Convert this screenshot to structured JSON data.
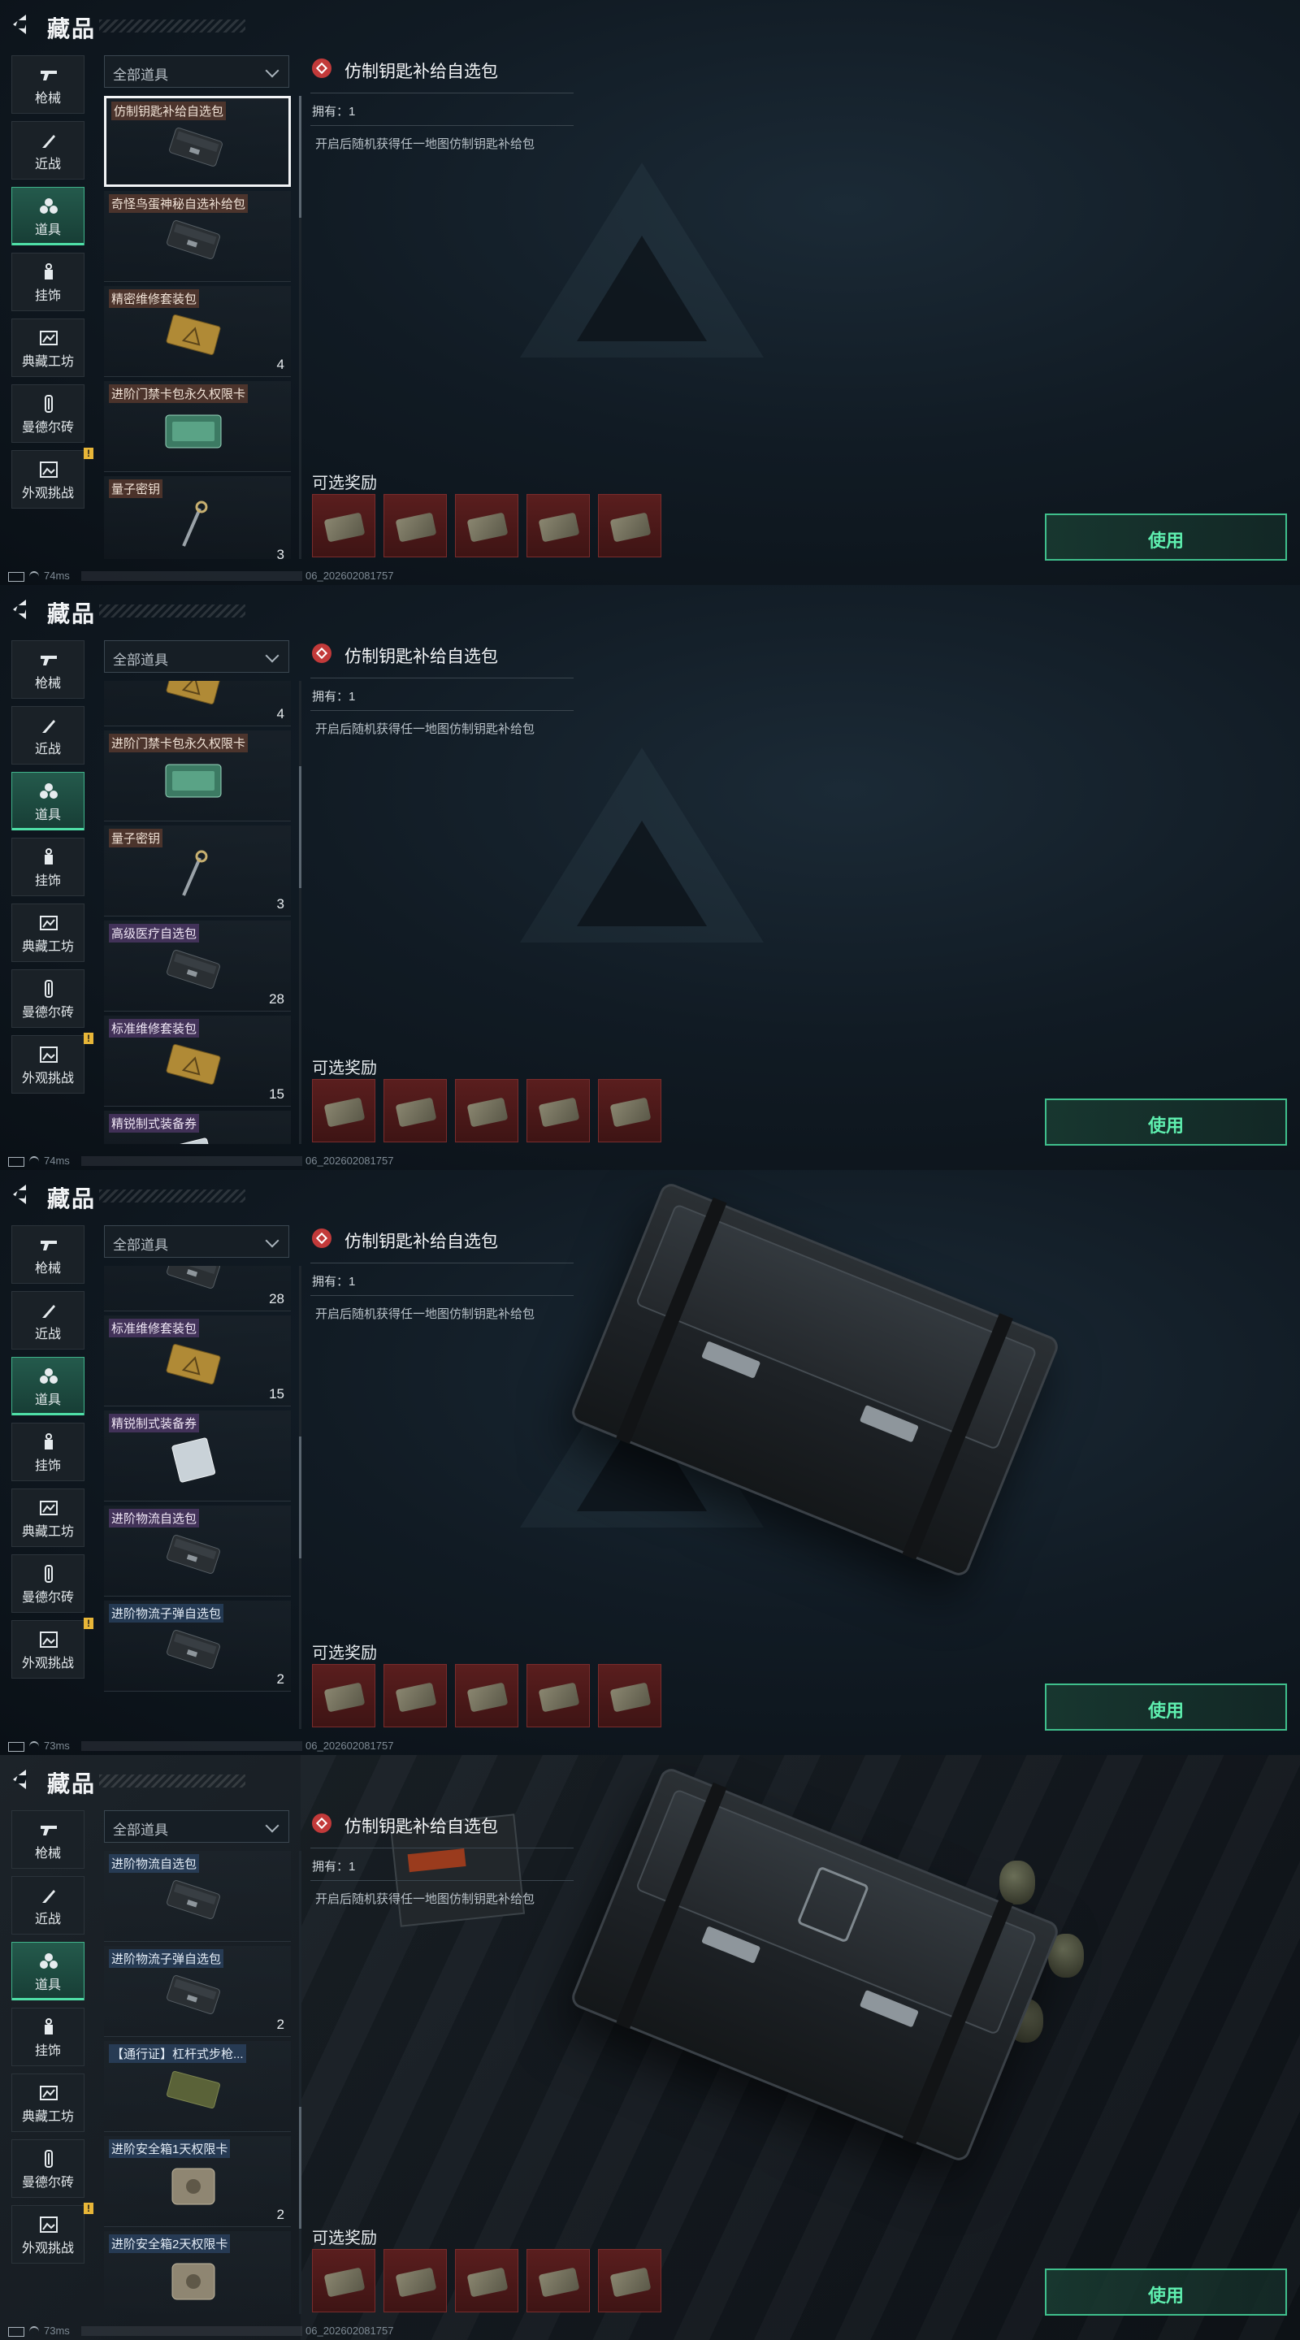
{
  "header": {
    "back_label": "",
    "title": "藏品"
  },
  "sidebar": {
    "items": [
      {
        "label": "枪械",
        "icon": "gun-icon",
        "active": false
      },
      {
        "label": "近战",
        "icon": "knife-icon",
        "active": false
      },
      {
        "label": "道具",
        "icon": "items-icon",
        "active": true
      },
      {
        "label": "挂饰",
        "icon": "charm-icon",
        "active": false
      },
      {
        "label": "典藏工坊",
        "icon": "workshop-icon",
        "active": false
      },
      {
        "label": "曼德尔砖",
        "icon": "brick-icon",
        "active": false
      },
      {
        "label": "外观挑战",
        "icon": "challenge-icon",
        "active": false,
        "badge": "!"
      }
    ]
  },
  "filter": {
    "selected": "全部道具"
  },
  "detail": {
    "title": "仿制钥匙补给自选包",
    "owned": "拥有：1",
    "description": "开启后随机获得任一地图仿制钥匙补给包",
    "rewards_label": "可选奖励",
    "reward_count": 5,
    "use_label": "使用"
  },
  "panels": [
    {
      "ping": "74ms",
      "build": "06_202602081757",
      "scene": false,
      "chest_visible": false,
      "scroll_fraction": 0.0,
      "items": [
        {
          "name": "仿制钥匙补给自选包",
          "count": "",
          "selected": true,
          "tone": "brown",
          "thumb": "dark-box"
        },
        {
          "name": "奇怪鸟蛋神秘自选补给包",
          "count": "",
          "selected": false,
          "tone": "brown",
          "thumb": "dark-box"
        },
        {
          "name": "精密维修套装包",
          "count": "4",
          "selected": false,
          "tone": "brown",
          "thumb": "yellow-box"
        },
        {
          "name": "进阶门禁卡包永久权限卡",
          "count": "",
          "selected": false,
          "tone": "brown",
          "thumb": "green-card"
        },
        {
          "name": "量子密钥",
          "count": "3",
          "selected": false,
          "tone": "brown",
          "thumb": "key"
        }
      ]
    },
    {
      "ping": "74ms",
      "build": "06_202602081757",
      "scene": false,
      "chest_visible": false,
      "scroll_fraction": 0.25,
      "items": [
        {
          "name": "",
          "count": "4",
          "selected": false,
          "tone": "brown",
          "thumb": "yellow-box"
        },
        {
          "name": "进阶门禁卡包永久权限卡",
          "count": "",
          "selected": false,
          "tone": "brown",
          "thumb": "green-card"
        },
        {
          "name": "量子密钥",
          "count": "3",
          "selected": false,
          "tone": "brown",
          "thumb": "key"
        },
        {
          "name": "高级医疗自选包",
          "count": "28",
          "selected": false,
          "tone": "purple",
          "thumb": "dark-box"
        },
        {
          "name": "标准维修套装包",
          "count": "15",
          "selected": false,
          "tone": "purple",
          "thumb": "yellow-box"
        },
        {
          "name": "精锐制式装备券",
          "count": "",
          "selected": false,
          "tone": "purple",
          "thumb": "ticket"
        }
      ]
    },
    {
      "ping": "73ms",
      "build": "06_202602081757",
      "scene": false,
      "chest_visible": true,
      "scroll_fraction": 0.5,
      "items": [
        {
          "name": "",
          "count": "28",
          "selected": false,
          "tone": "purple",
          "thumb": "dark-box"
        },
        {
          "name": "标准维修套装包",
          "count": "15",
          "selected": false,
          "tone": "purple",
          "thumb": "yellow-box"
        },
        {
          "name": "精锐制式装备券",
          "count": "",
          "selected": false,
          "tone": "purple",
          "thumb": "ticket"
        },
        {
          "name": "进阶物流自选包",
          "count": "",
          "selected": false,
          "tone": "purple",
          "thumb": "dark-box"
        },
        {
          "name": "进阶物流子弹自选包",
          "count": "2",
          "selected": false,
          "tone": "blue",
          "thumb": "dark-box"
        }
      ]
    },
    {
      "ping": "73ms",
      "build": "06_202602081757",
      "scene": true,
      "chest_visible": true,
      "scroll_fraction": 0.75,
      "items": [
        {
          "name": "进阶物流自选包",
          "count": "",
          "selected": false,
          "tone": "blue",
          "thumb": "dark-box"
        },
        {
          "name": "进阶物流子弹自选包",
          "count": "2",
          "selected": false,
          "tone": "blue",
          "thumb": "dark-box"
        },
        {
          "name": "【通行证】杠杆式步枪...",
          "count": "",
          "selected": false,
          "tone": "blue",
          "thumb": "olive-box"
        },
        {
          "name": "进阶安全箱1天权限卡",
          "count": "2",
          "selected": false,
          "tone": "blue",
          "thumb": "safe"
        },
        {
          "name": "进阶安全箱2天权限卡",
          "count": "",
          "selected": false,
          "tone": "blue",
          "thumb": "safe"
        }
      ]
    }
  ],
  "colors": {
    "accent": "#4fe0a8",
    "reward_bg": "#5a1e1e",
    "selected_border": "#f2f4f6",
    "badge": "#e8b638"
  }
}
